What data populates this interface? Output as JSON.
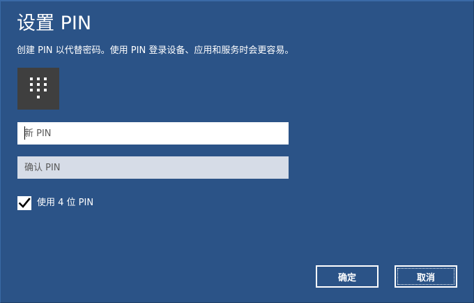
{
  "dialog": {
    "title": "设置 PIN",
    "subtitle": "创建 PIN 以代替密码。使用 PIN 登录设备、应用和服务时会更容易。",
    "icon": "keypad-icon"
  },
  "fields": {
    "new_pin": {
      "placeholder": "新 PIN",
      "value": ""
    },
    "confirm_pin": {
      "placeholder": "确认 PIN",
      "value": ""
    }
  },
  "options": {
    "four_digit": {
      "label": "使用 4 位 PIN",
      "checked": true
    }
  },
  "buttons": {
    "ok_label": "确定",
    "cancel_label": "取消"
  },
  "colors": {
    "background": "#2b5387",
    "tile": "#3f3f3f",
    "input_active": "#ffffff",
    "input_inactive": "#d6dce7"
  }
}
